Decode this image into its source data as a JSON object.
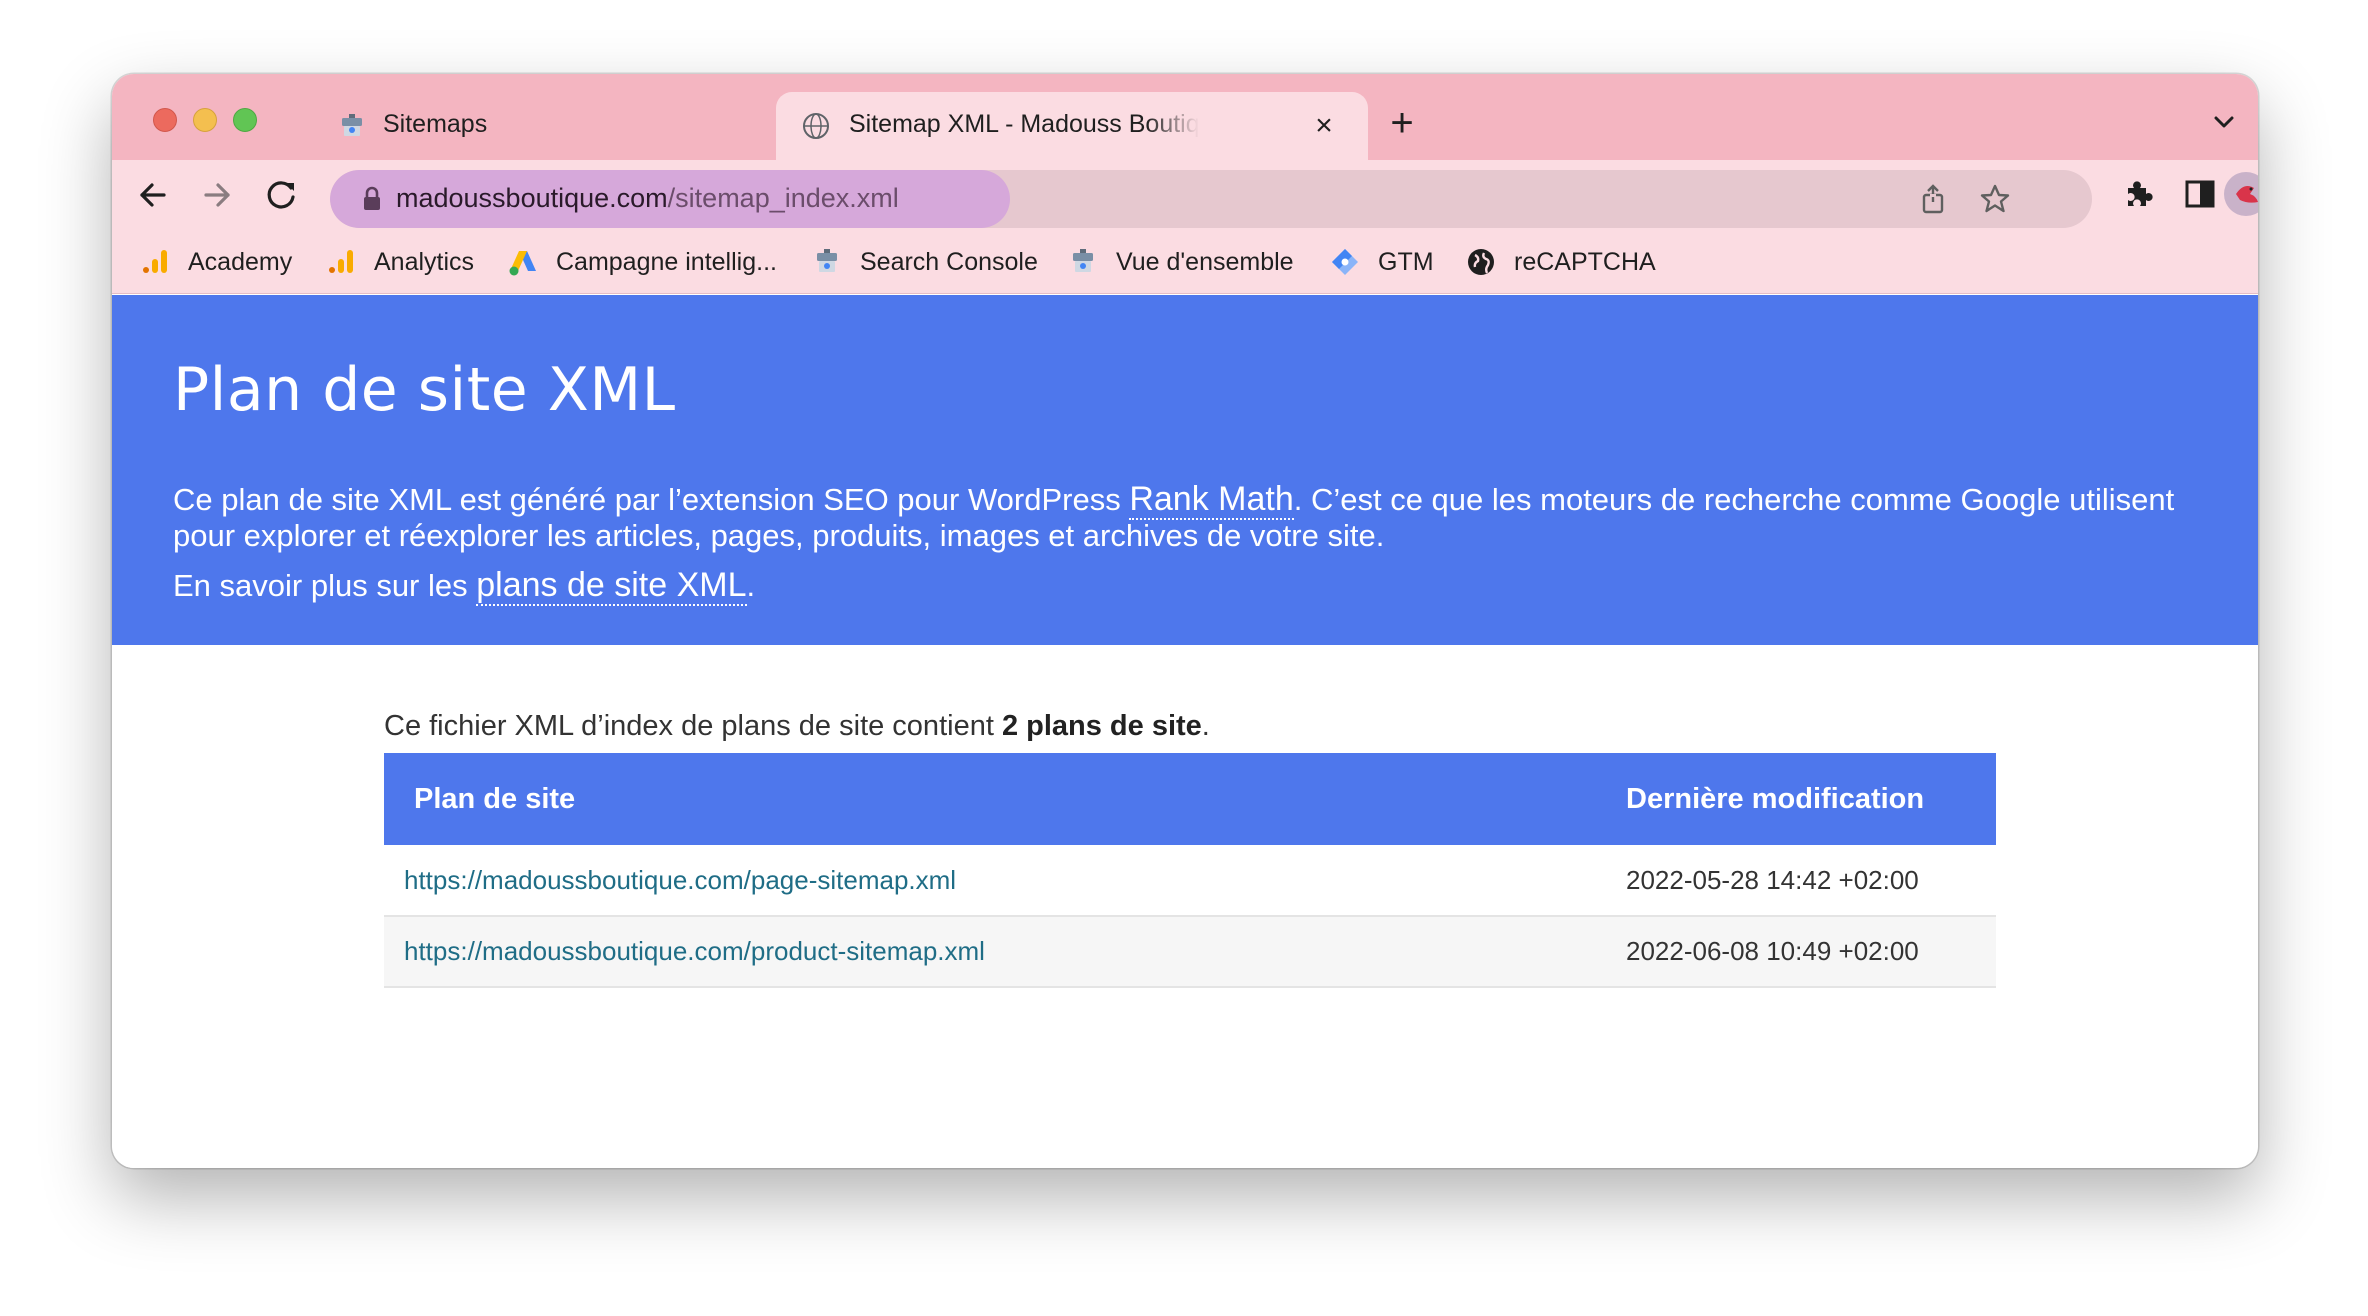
{
  "tabs": [
    {
      "title": "Sitemaps",
      "favicon": "search-console-icon",
      "active": false
    },
    {
      "title": "Sitemap XML - Madouss Boutique",
      "favicon": "globe-icon",
      "active": true
    }
  ],
  "toolbar": {
    "url_host": "madoussboutique.com",
    "url_path": "/sitemap_index.xml"
  },
  "bookmarks": [
    {
      "label": "Academy",
      "icon": "analytics-icon"
    },
    {
      "label": "Analytics",
      "icon": "analytics-icon"
    },
    {
      "label": "Campagne intellig...",
      "icon": "google-ads-icon"
    },
    {
      "label": "Search Console",
      "icon": "search-console-icon"
    },
    {
      "label": "Vue d'ensemble",
      "icon": "search-console-icon"
    },
    {
      "label": "GTM",
      "icon": "gtm-icon"
    },
    {
      "label": "reCAPTCHA",
      "icon": "globe-icon"
    }
  ],
  "hero": {
    "title": "Plan de site XML",
    "desc_before": "Ce plan de site XML est généré par l’extension SEO pour WordPress ",
    "desc_link": "Rank Math",
    "desc_after": ". C’est ce que les moteurs de recherche comme Google utilisent pour explorer et réexplorer les articles, pages, produits, images et archives de votre site.",
    "learn_before": "En savoir plus sur les ",
    "learn_link": "plans de site XML",
    "learn_after": "."
  },
  "intro": {
    "before": "Ce fichier XML d’index de plans de site contient ",
    "count": "2 plans de site",
    "after": "."
  },
  "table": {
    "headers": [
      "Plan de site",
      "Dernière modification"
    ],
    "rows": [
      {
        "loc": "https://madoussboutique.com/page-sitemap.xml",
        "lastmod": "2022-05-28 14:42 +02:00"
      },
      {
        "loc": "https://madoussboutique.com/product-sitemap.xml",
        "lastmod": "2022-06-08 10:49 +02:00"
      }
    ]
  },
  "colors": {
    "tab_strip": "#f4b5c1",
    "toolbar": "#fbdce2",
    "hero": "#4e77ec",
    "link": "#1f6d86"
  }
}
